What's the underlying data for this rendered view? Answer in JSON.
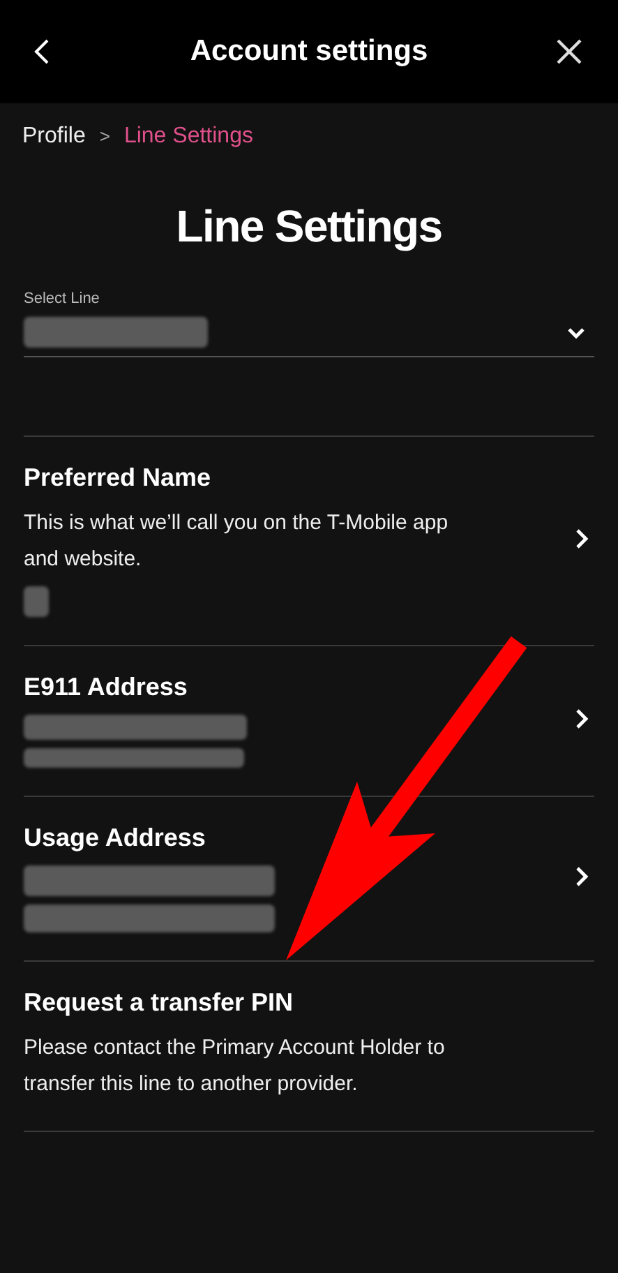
{
  "header": {
    "title": "Account settings"
  },
  "breadcrumb": [
    {
      "label": "Profile",
      "selected": false
    },
    {
      "label": ">",
      "kind": "separator"
    },
    {
      "label": "Line Settings",
      "selected": true
    }
  ],
  "heading": "Line Settings",
  "select_line": {
    "label": "Select Line"
  },
  "items": [
    {
      "title": "Preferred Name",
      "description": "This is what we’ll call you on the T-Mobile app and website.",
      "has_chevron": true
    },
    {
      "title": "E911 Address",
      "has_chevron": true
    },
    {
      "title": "Usage Address",
      "has_chevron": true
    },
    {
      "title": "Request a transfer PIN",
      "description": "Please contact the Primary Account Holder to transfer this line to another provider.",
      "has_chevron": false
    }
  ]
}
